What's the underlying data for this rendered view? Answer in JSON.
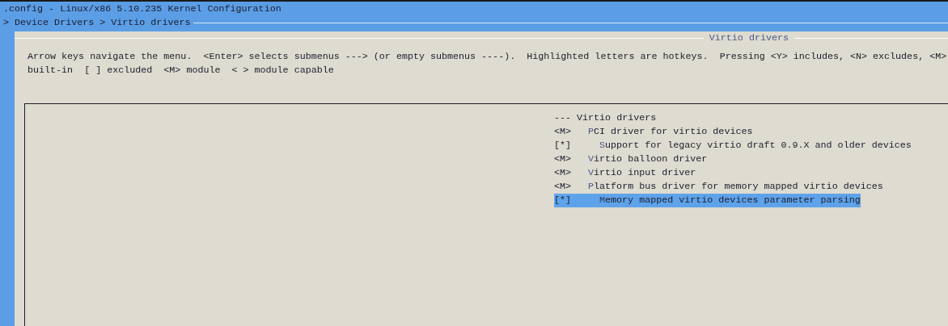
{
  "window": {
    "title": ".config - Linux/x86 5.10.235 Kernel Configuration"
  },
  "breadcrumb": "> Device Drivers > Virtio drivers",
  "dialog": {
    "title": "Virtio drivers",
    "help": [
      "Arrow keys navigate the menu.  <Enter> selects submenus ---> (or empty submenus ----).  Highlighted letters are hotkeys.  Pressing <Y> includes, <N> excludes, <M>",
      "built-in  [ ] excluded  <M> module  < > module capable"
    ]
  },
  "menu": [
    {
      "kind": "heading",
      "prefix": "---",
      "label": "Virtio drivers",
      "selected": false
    },
    {
      "kind": "option",
      "prefix": "<M>",
      "hotkey": "P",
      "label": "CI driver for virtio devices",
      "indented": false,
      "selected": false
    },
    {
      "kind": "option",
      "prefix": "[*]",
      "hotkey": "S",
      "label": "upport for legacy virtio draft 0.9.X and older devices",
      "indented": true,
      "selected": false
    },
    {
      "kind": "option",
      "prefix": "<M>",
      "hotkey": "V",
      "label": "irtio balloon driver",
      "indented": false,
      "selected": false
    },
    {
      "kind": "option",
      "prefix": "<M>",
      "hotkey": "V",
      "label": "irtio input driver",
      "indented": false,
      "selected": false
    },
    {
      "kind": "option",
      "prefix": "<M>",
      "hotkey": "P",
      "label": "latform bus driver for memory mapped virtio devices",
      "indented": false,
      "selected": false
    },
    {
      "kind": "option",
      "prefix": "[*]",
      "hotkey": "M",
      "label": "emory mapped virtio devices parameter parsing",
      "indented": true,
      "selected": true
    }
  ]
}
